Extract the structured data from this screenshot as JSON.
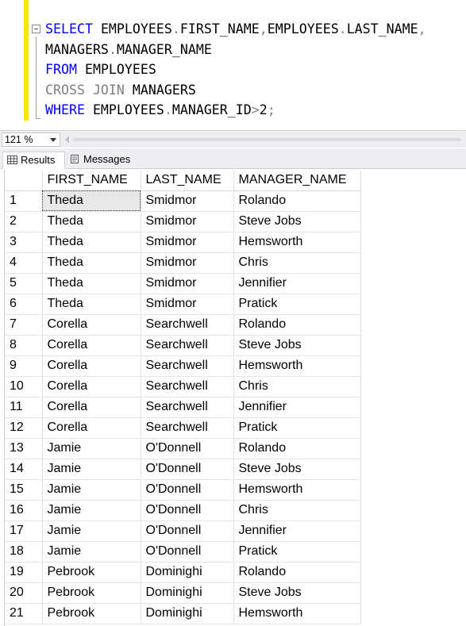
{
  "editor": {
    "lines": [
      [
        {
          "t": "SELECT",
          "c": "kw"
        },
        {
          "t": " EMPLOYEES"
        },
        {
          "t": ".",
          "c": "op"
        },
        {
          "t": "FIRST_NAME"
        },
        {
          "t": ",",
          "c": "op"
        },
        {
          "t": "EMPLOYEES"
        },
        {
          "t": ".",
          "c": "op"
        },
        {
          "t": "LAST_NAME"
        },
        {
          "t": ",",
          "c": "op"
        }
      ],
      [
        {
          "t": "MANAGERS"
        },
        {
          "t": ".",
          "c": "op"
        },
        {
          "t": "MANAGER_NAME"
        }
      ],
      [
        {
          "t": "FROM",
          "c": "kw"
        },
        {
          "t": " EMPLOYEES"
        }
      ],
      [
        {
          "t": "CROSS JOIN",
          "c": "kwg"
        },
        {
          "t": " MANAGERS"
        }
      ],
      [
        {
          "t": "WHERE",
          "c": "kw"
        },
        {
          "t": " EMPLOYEES"
        },
        {
          "t": ".",
          "c": "op"
        },
        {
          "t": "MANAGER_ID"
        },
        {
          "t": ">",
          "c": "op"
        },
        {
          "t": "2"
        },
        {
          "t": ";",
          "c": "op"
        }
      ]
    ]
  },
  "zoom": {
    "value": "121 %"
  },
  "tabs": {
    "results": "Results",
    "messages": "Messages"
  },
  "grid": {
    "columns": [
      "FIRST_NAME",
      "LAST_NAME",
      "MANAGER_NAME"
    ],
    "rows": [
      [
        "1",
        "Theda",
        "Smidmor",
        "Rolando"
      ],
      [
        "2",
        "Theda",
        "Smidmor",
        "Steve Jobs"
      ],
      [
        "3",
        "Theda",
        "Smidmor",
        "Hemsworth"
      ],
      [
        "4",
        "Theda",
        "Smidmor",
        "Chris"
      ],
      [
        "5",
        "Theda",
        "Smidmor",
        "Jennifier"
      ],
      [
        "6",
        "Theda",
        "Smidmor",
        "Pratick"
      ],
      [
        "7",
        "Corella",
        "Searchwell",
        "Rolando"
      ],
      [
        "8",
        "Corella",
        "Searchwell",
        "Steve Jobs"
      ],
      [
        "9",
        "Corella",
        "Searchwell",
        "Hemsworth"
      ],
      [
        "10",
        "Corella",
        "Searchwell",
        "Chris"
      ],
      [
        "11",
        "Corella",
        "Searchwell",
        "Jennifier"
      ],
      [
        "12",
        "Corella",
        "Searchwell",
        "Pratick"
      ],
      [
        "13",
        "Jamie",
        "O'Donnell",
        "Rolando"
      ],
      [
        "14",
        "Jamie",
        "O'Donnell",
        "Steve Jobs"
      ],
      [
        "15",
        "Jamie",
        "O'Donnell",
        "Hemsworth"
      ],
      [
        "16",
        "Jamie",
        "O'Donnell",
        "Chris"
      ],
      [
        "17",
        "Jamie",
        "O'Donnell",
        "Jennifier"
      ],
      [
        "18",
        "Jamie",
        "O'Donnell",
        "Pratick"
      ],
      [
        "19",
        "Pebrook",
        "Dominighi",
        "Rolando"
      ],
      [
        "20",
        "Pebrook",
        "Dominighi",
        "Steve Jobs"
      ],
      [
        "21",
        "Pebrook",
        "Dominighi",
        "Hemsworth"
      ]
    ]
  }
}
